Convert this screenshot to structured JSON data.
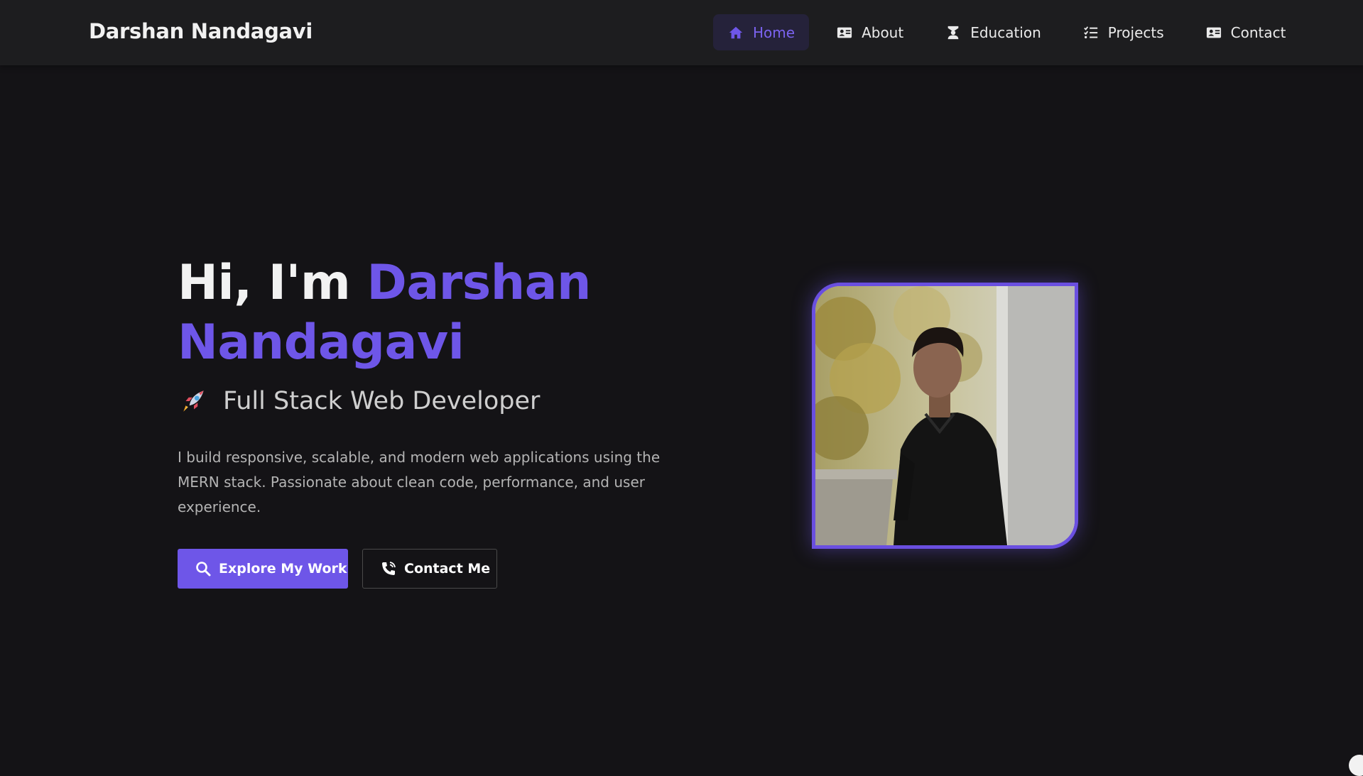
{
  "brand": "Darshan Nandagavi",
  "nav": {
    "items": [
      {
        "label": "Home",
        "icon": "home-icon",
        "active": true
      },
      {
        "label": "About",
        "icon": "id-card-icon"
      },
      {
        "label": "Education",
        "icon": "graduation-icon"
      },
      {
        "label": "Projects",
        "icon": "list-check-icon"
      },
      {
        "label": "Contact",
        "icon": "address-card-icon"
      }
    ]
  },
  "hero": {
    "greeting": "Hi, I'm",
    "name_first": "Darshan",
    "name_last": "Nandagavi",
    "role": "Full Stack Web Developer",
    "role_icon": "rocket-icon",
    "description": "I build responsive, scalable, and modern web applications using the MERN stack. Passionate about clean code, performance, and user experience."
  },
  "buttons": {
    "explore": "Explore My Work",
    "contact": "Contact Me"
  },
  "photo": {
    "icon": "profile-photo"
  },
  "colors": {
    "accent": "#6e56e8",
    "background": "#141316",
    "navbar": "#1d1d1f"
  }
}
